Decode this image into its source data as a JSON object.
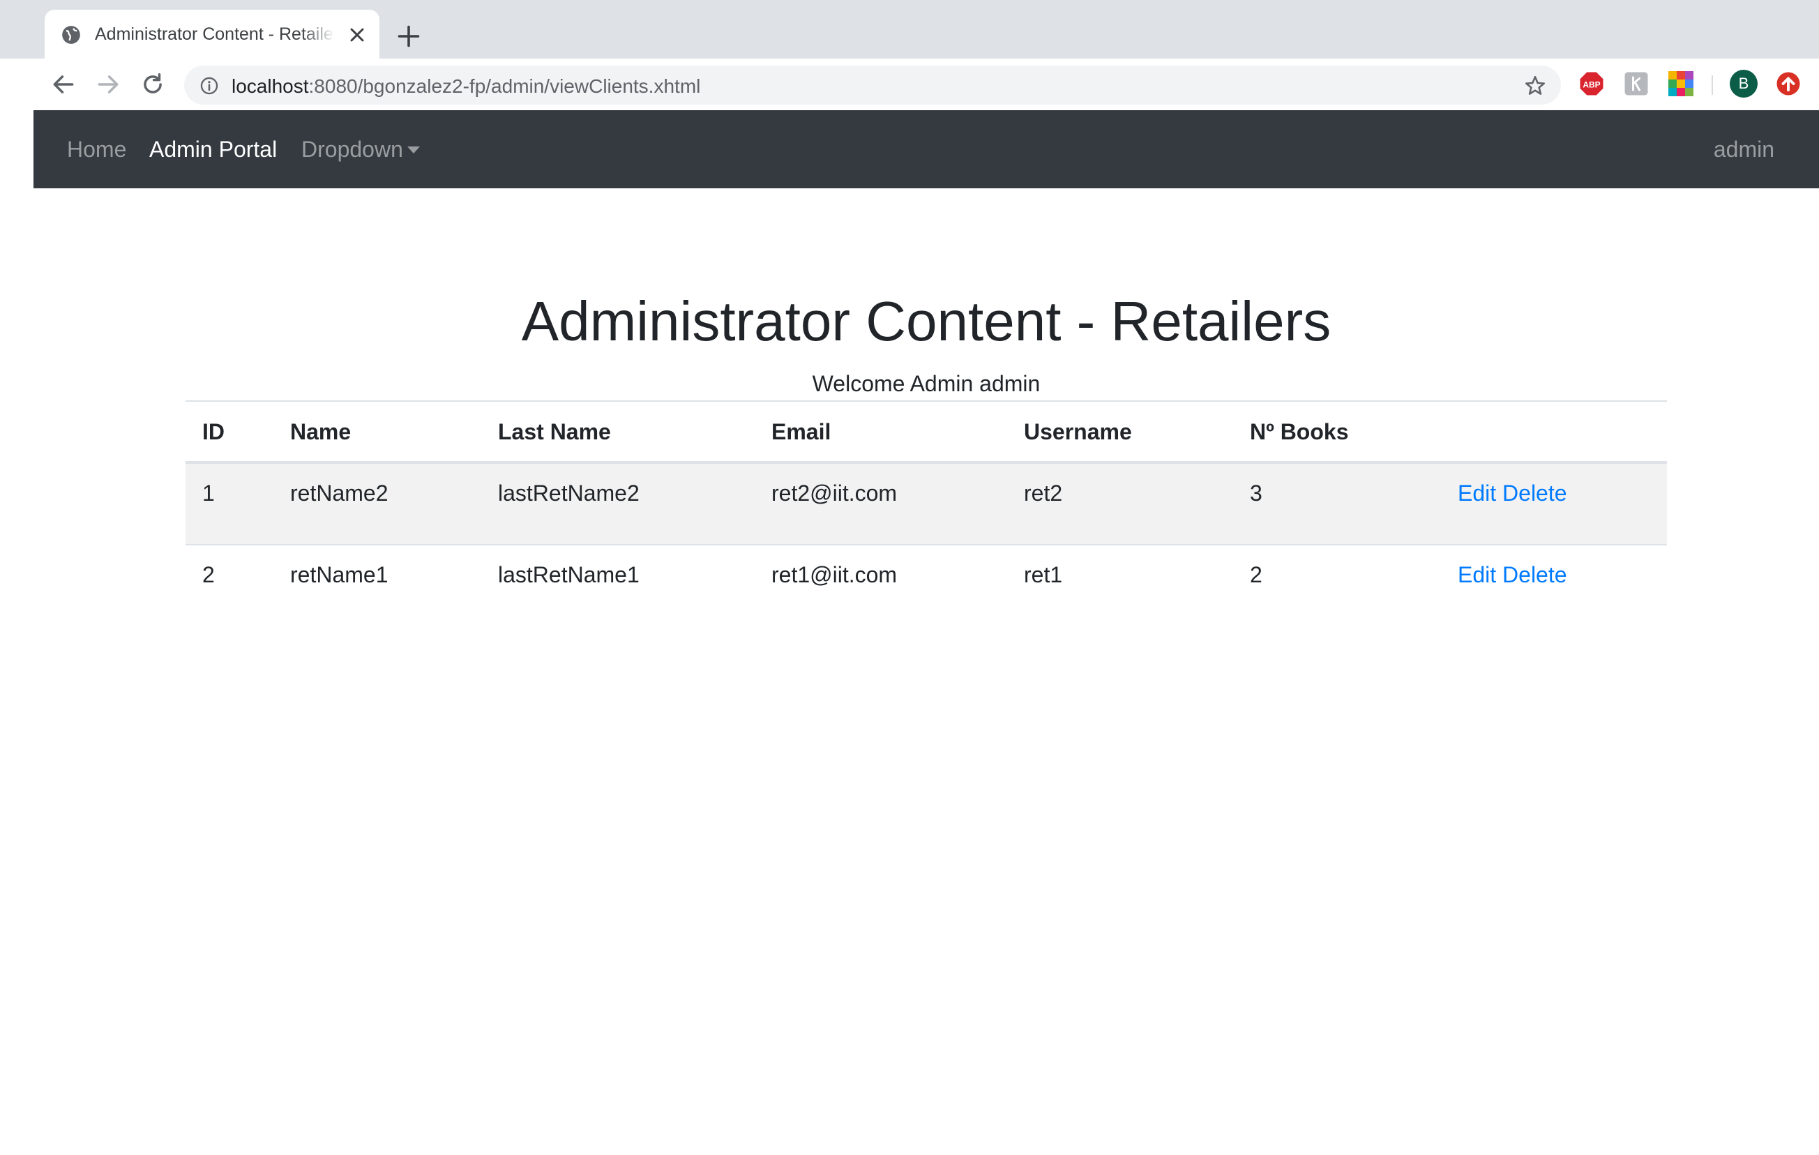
{
  "browser": {
    "tab_title": "Administrator Content - Retailers",
    "url_host": "localhost",
    "url_path": ":8080/bgonzalez2-fp/admin/viewClients.xhtml",
    "avatar_letter": "B",
    "icons": [
      "globe-icon",
      "close-icon",
      "plus-icon",
      "back-arrow-icon",
      "forward-arrow-icon",
      "reload-icon",
      "info-icon",
      "star-icon",
      "adblock-icon",
      "extension-icon",
      "color-grid-icon",
      "update-icon"
    ]
  },
  "navbar": {
    "brand_bg": "#343a40",
    "items": [
      {
        "label": "Home"
      },
      {
        "label": "Admin Portal"
      },
      {
        "label": "Dropdown"
      }
    ],
    "user": "admin"
  },
  "page": {
    "title": "Administrator Content - Retailers",
    "welcome": "Welcome Admin admin"
  },
  "table": {
    "headers": [
      "ID",
      "Name",
      "Last Name",
      "Email",
      "Username",
      "Nº Books",
      ""
    ],
    "rows": [
      {
        "id": "1",
        "name": "retName2",
        "last_name": "lastRetName2",
        "email": "ret2@iit.com",
        "username": "ret2",
        "books": "3",
        "edit": "Edit",
        "delete": "Delete"
      },
      {
        "id": "2",
        "name": "retName1",
        "last_name": "lastRetName1",
        "email": "ret1@iit.com",
        "username": "ret1",
        "books": "2",
        "edit": "Edit",
        "delete": "Delete"
      }
    ]
  },
  "colors": {
    "link": "#007bff",
    "navbar": "#343a40",
    "stripe": "#f2f2f2"
  }
}
